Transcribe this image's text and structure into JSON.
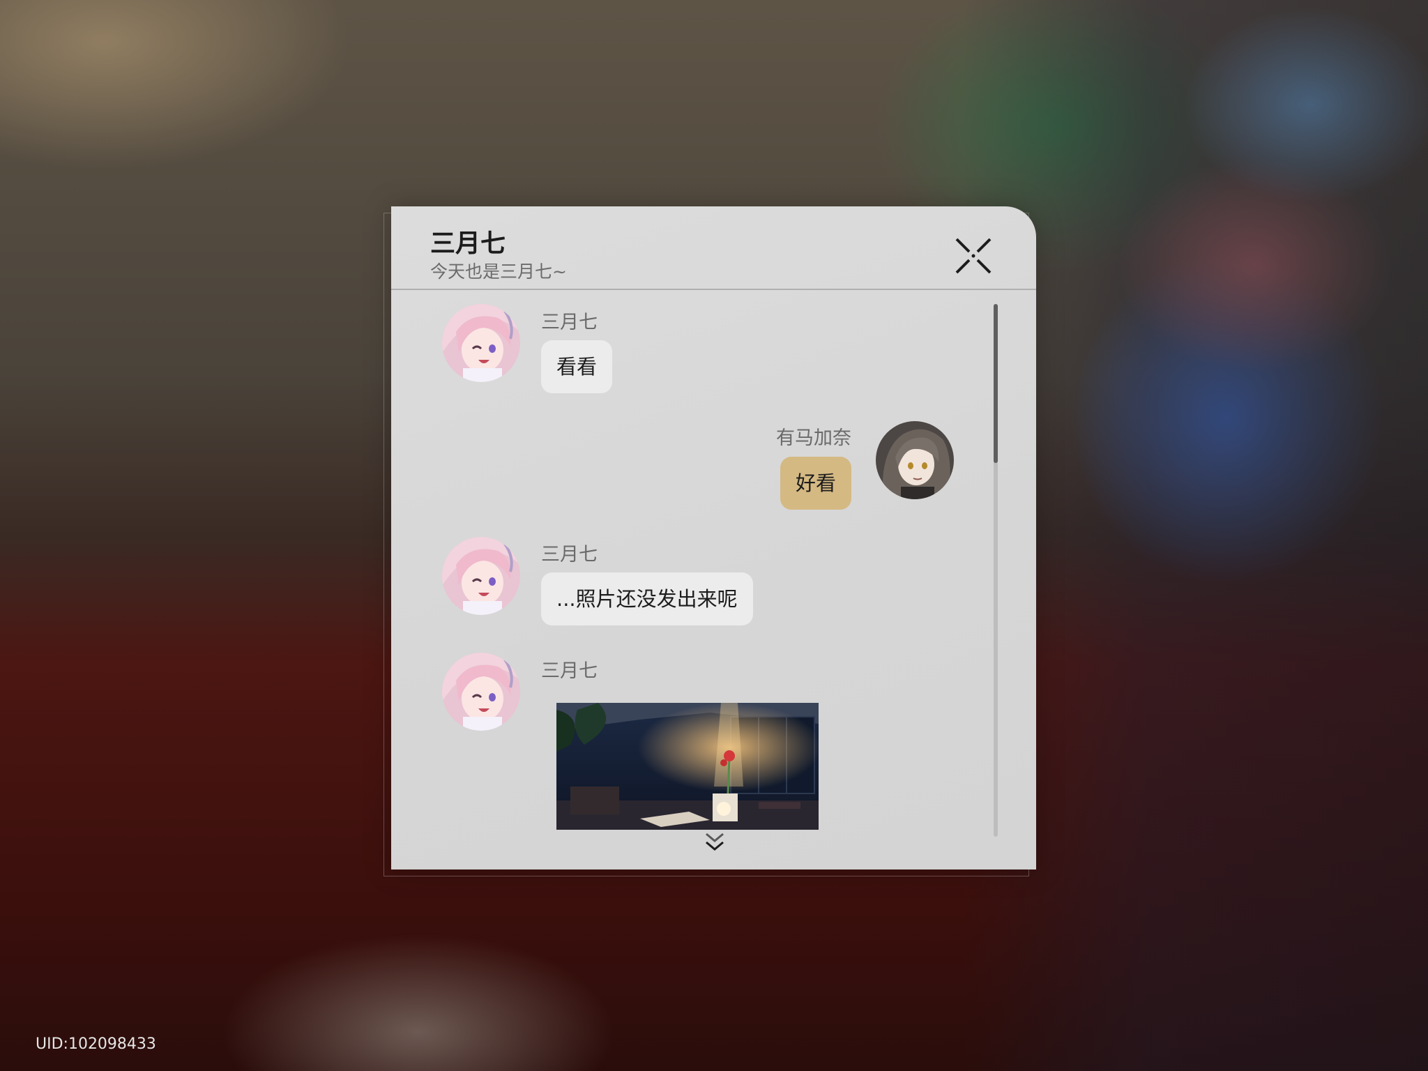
{
  "chat": {
    "title": "三月七",
    "subtitle": "今天也是三月七~",
    "close_icon": "close-icon"
  },
  "messages": [
    {
      "sender": "三月七",
      "text": "看看",
      "side": "left",
      "avatar": "march7th-avatar"
    },
    {
      "sender": "有马加奈",
      "text": "好看",
      "side": "right",
      "avatar": "player-avatar"
    },
    {
      "sender": "三月七",
      "text": "...照片还没发出来呢",
      "side": "left",
      "avatar": "march7th-avatar"
    },
    {
      "sender": "三月七",
      "type": "image",
      "image": "rose-in-vase-photo",
      "side": "left",
      "avatar": "march7th-avatar"
    }
  ],
  "colors": {
    "incoming_bubble": "#ececec",
    "outgoing_bubble": "#d5b983",
    "panel": "#d8d8d8"
  },
  "footer": {
    "uid": "UID:102098433"
  }
}
